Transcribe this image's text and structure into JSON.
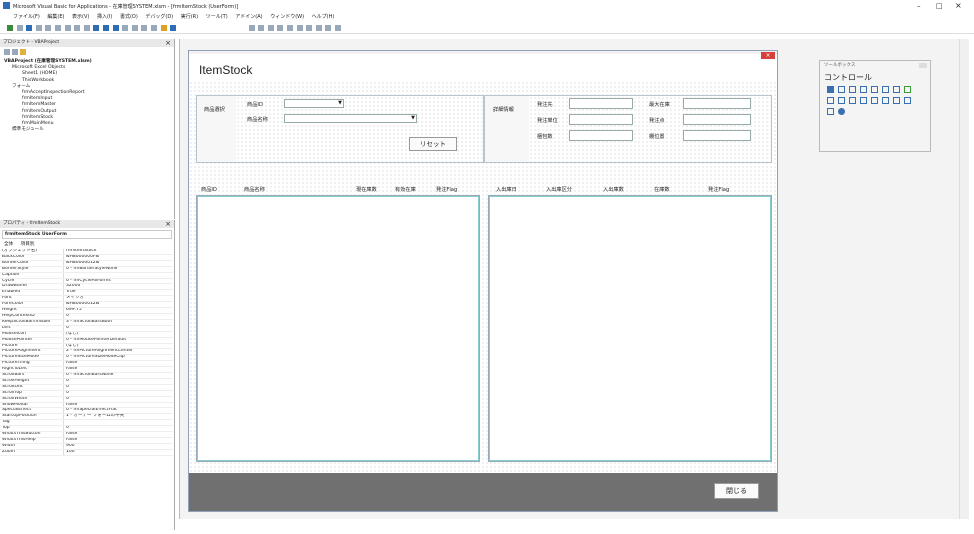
{
  "window": {
    "title": "Microsoft Visual Basic for Applications - 在庫管理SYSTEM.xlsm - [frmItemStock (UserForm)]",
    "controls": {
      "minimize": "–",
      "maximize": "□",
      "close": "×"
    }
  },
  "menubar": [
    "ファイル(F)",
    "編集(E)",
    "表示(V)",
    "挿入(I)",
    "書式(O)",
    "デバッグ(D)",
    "実行(R)",
    "ツール(T)",
    "アドイン(A)",
    "ウィンドウ(W)",
    "ヘルプ(H)"
  ],
  "project": {
    "title": "プロジェクト - VBAProject",
    "root": "VBAProject (在庫管理SYSTEM.xlsm)",
    "excel_objects": "Microsoft Excel Objects",
    "sheet": "Sheet1 (HOME)",
    "workbook": "ThisWorkbook",
    "forms_folder": "フォーム",
    "forms": [
      "frmAcceptInspectionReport",
      "frmItemInput",
      "frmItemMaster",
      "frmItemOutput",
      "frmItemStock",
      "frmMainMenu"
    ],
    "modules": "標準モジュール"
  },
  "properties": {
    "title": "プロパティ - frmItemStock",
    "object": "frmItemStock UserForm",
    "tabs": [
      "全体",
      "項目別"
    ],
    "rows": [
      [
        "(オブジェクト名)",
        "frmItemStock"
      ],
      [
        "BackColor",
        "&H8000000F&"
      ],
      [
        "BorderColor",
        "&H80000012&"
      ],
      [
        "BorderStyle",
        "0 - fmBorderStyleNone"
      ],
      [
        "Caption",
        ""
      ],
      [
        "Cycle",
        "0 - fmCycleAllForms"
      ],
      [
        "DrawBuffer",
        "32000"
      ],
      [
        "Enabled",
        "True"
      ],
      [
        "Font",
        "メイリオ"
      ],
      [
        "ForeColor",
        "&H80000012&"
      ],
      [
        "Height",
        "699.75"
      ],
      [
        "HelpContextID",
        "0"
      ],
      [
        "KeepScrollBarsVisible",
        "3 - fmScrollBarsBoth"
      ],
      [
        "Left",
        "0"
      ],
      [
        "MouseIcon",
        "(なし)"
      ],
      [
        "MousePointer",
        "0 - fmMousePointerDefault"
      ],
      [
        "Picture",
        "(なし)"
      ],
      [
        "PictureAlignment",
        "2 - fmPictureAlignmentCenter"
      ],
      [
        "PictureSizeMode",
        "0 - fmPictureSizeModeClip"
      ],
      [
        "PictureTiling",
        "False"
      ],
      [
        "RightToLeft",
        "False"
      ],
      [
        "ScrollBars",
        "0 - fmScrollBarsNone"
      ],
      [
        "ScrollHeight",
        "0"
      ],
      [
        "ScrollLeft",
        "0"
      ],
      [
        "ScrollTop",
        "0"
      ],
      [
        "ScrollWidth",
        "0"
      ],
      [
        "ShowModal",
        "False"
      ],
      [
        "SpecialEffect",
        "0 - fmSpecialEffectFlat"
      ],
      [
        "StartUpPosition",
        "1 - オーナー フォームの中央"
      ],
      [
        "Tag",
        ""
      ],
      [
        "Top",
        "0"
      ],
      [
        "WhatsThisButton",
        "False"
      ],
      [
        "WhatsThisHelp",
        "False"
      ],
      [
        "Width",
        "900"
      ],
      [
        "Zoom",
        "100"
      ]
    ]
  },
  "form": {
    "caption": "ItemStock",
    "select_group": "商品選択",
    "item_id": "商品ID",
    "item_name": "商品名称",
    "reset": "リセット",
    "detail_group": "詳細情報",
    "order_to": "発注先",
    "order_unit": "発注単位",
    "packing": "梱包数",
    "max_stock": "最大在庫",
    "order_point": "発注点",
    "location": "棚位置",
    "left_headers": [
      "商品ID",
      "商品名称",
      "現在庫数",
      "有効在庫",
      "発注Flag"
    ],
    "right_headers": [
      "入出庫日",
      "入出庫区分",
      "入出庫数",
      "在庫数",
      "発注Flag"
    ],
    "close": "閉じる"
  },
  "toolbox": {
    "title": "ツールボックス",
    "tab": "コントロール"
  }
}
